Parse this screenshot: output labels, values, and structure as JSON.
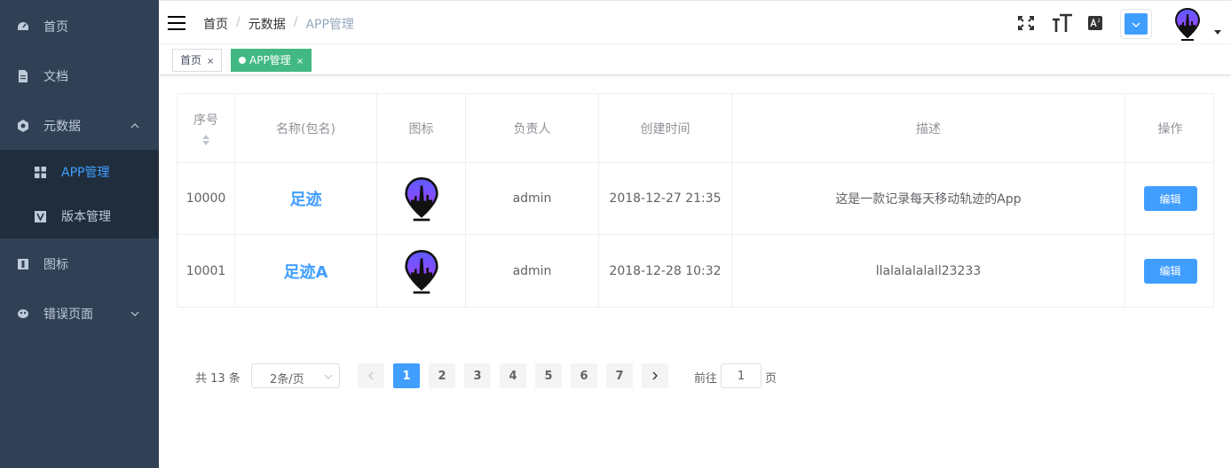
{
  "sidebar": {
    "items": [
      {
        "label": "首页"
      },
      {
        "label": "文档"
      },
      {
        "label": "元数据"
      },
      {
        "label": "图标"
      },
      {
        "label": "错误页面"
      }
    ],
    "submenu": [
      {
        "label": "APP管理",
        "active": true
      },
      {
        "label": "版本管理"
      }
    ]
  },
  "navbar": {
    "breadcrumb": [
      "首页",
      "元数据",
      "APP管理"
    ],
    "separator": "/",
    "theme_color": "#409eff"
  },
  "tags": [
    {
      "label": "首页",
      "close": "×"
    },
    {
      "label": "APP管理",
      "close": "×",
      "active": true
    }
  ],
  "table": {
    "headers": [
      "序号",
      "名称(包名)",
      "图标",
      "负责人",
      "创建时间",
      "描述",
      "操作"
    ],
    "rows": [
      {
        "id": "10000",
        "name": "足迹",
        "owner": "admin",
        "created": "2018-12-27 21:35",
        "desc": "这是一款记录每天移动轨迹的App",
        "action": "编辑"
      },
      {
        "id": "10001",
        "name": "足迹A",
        "owner": "admin",
        "created": "2018-12-28 10:32",
        "desc": "llalalalalall23233",
        "action": "编辑"
      }
    ]
  },
  "pagination": {
    "total": "共 13 条",
    "page_size": "2条/页",
    "pages": [
      "1",
      "2",
      "3",
      "4",
      "5",
      "6",
      "7"
    ],
    "current": "1",
    "goto_label": "前往",
    "goto_value": "1",
    "goto_suffix": "页"
  }
}
